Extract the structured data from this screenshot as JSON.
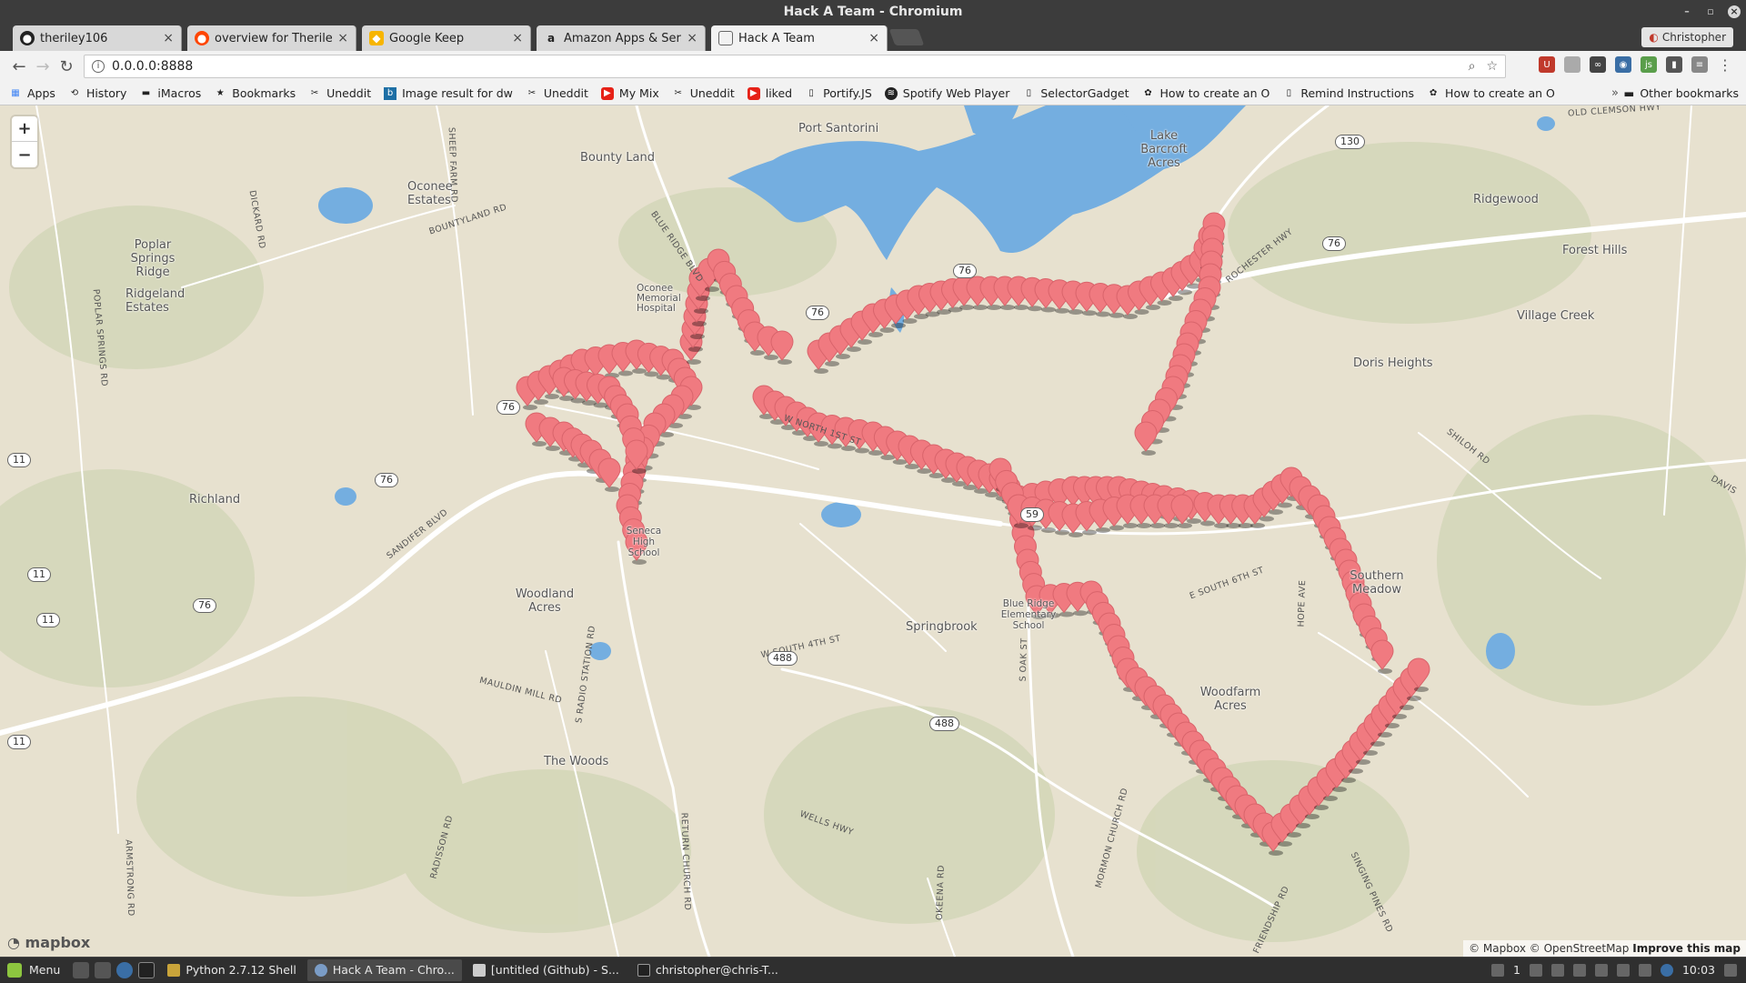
{
  "window": {
    "title": "Hack A Team - Chromium"
  },
  "tabs": [
    {
      "label": "theriley106",
      "icon": "github-icon"
    },
    {
      "label": "overview for Theriley106",
      "icon": "reddit-icon"
    },
    {
      "label": "Google Keep",
      "icon": "keep-icon"
    },
    {
      "label": "Amazon Apps & Services",
      "icon": "amazon-icon"
    },
    {
      "label": "Hack A Team",
      "icon": "page-icon"
    }
  ],
  "profile": {
    "name": "Christopher"
  },
  "address": {
    "url": "0.0.0.0:8888"
  },
  "bookmarks": [
    {
      "label": "Apps",
      "icon": "apps-grid-icon"
    },
    {
      "label": "History",
      "icon": "history-icon"
    },
    {
      "label": "iMacros",
      "icon": "folder-icon"
    },
    {
      "label": "Bookmarks",
      "icon": "star-icon"
    },
    {
      "label": "Uneddit",
      "icon": "scissors-icon"
    },
    {
      "label": "Image result for dw",
      "icon": "bing-icon"
    },
    {
      "label": "Uneddit",
      "icon": "scissors-icon"
    },
    {
      "label": "My Mix",
      "icon": "youtube-icon"
    },
    {
      "label": "Uneddit",
      "icon": "scissors-icon"
    },
    {
      "label": "liked",
      "icon": "youtube-icon"
    },
    {
      "label": "Portify.JS",
      "icon": "page-icon"
    },
    {
      "label": "Spotify Web Player",
      "icon": "spotify-icon"
    },
    {
      "label": "SelectorGadget",
      "icon": "page-icon"
    },
    {
      "label": "How to create an O",
      "icon": "octocat-icon"
    },
    {
      "label": "Remind Instructions",
      "icon": "page-icon"
    },
    {
      "label": "How to create an O",
      "icon": "octocat-icon"
    }
  ],
  "bookmarks_overflow": "»",
  "other_bookmarks": "Other bookmarks",
  "map": {
    "zoom_in": "+",
    "zoom_out": "−",
    "places": [
      "Port Santorini",
      "Lake Barcroft Acres",
      "Bounty Land",
      "Oconee Estates",
      "Poplar Springs Ridge",
      "Ridgeland Estates",
      "Ridgewood",
      "Forest Hills",
      "Village Creek",
      "Doris Heights",
      "Richland",
      "Seneca High School",
      "Woodland Acres",
      "Blue Ridge Elementary School",
      "Springbrook",
      "Southern Meadow",
      "Woodfarm Acres",
      "The Woods",
      "Oconee Memorial Hospital"
    ],
    "roads": [
      "SHEEP FARM RD",
      "BLUE RIDGE BLVD",
      "BOUNTYLAND RD",
      "DICKARD RD",
      "POPLAR SPRINGS RD",
      "SANDIFER BLVD",
      "ROCHESTER HWY",
      "W NORTH 1ST ST",
      "W SOUTH 4TH ST",
      "E SOUTH 6TH ST",
      "S OAK ST",
      "WELLS HWY",
      "S RADIO STATION RD",
      "MAULDIN MILL RD",
      "RETURN CHURCH RD",
      "RADISSON RD",
      "ARMSTRONG RD",
      "OKEENA RD",
      "MORMON CHURCH RD",
      "HOPE AVE",
      "SHILOH RD",
      "SINGING PINES RD",
      "FRIENDSHIP RD",
      "OLD CLEMSON HWY",
      "DAVIS"
    ],
    "shields": [
      "130",
      "76",
      "76",
      "76",
      "76",
      "76",
      "76",
      "11",
      "11",
      "11",
      "11",
      "59",
      "488",
      "488"
    ],
    "logo": "mapbox",
    "attribution": "© Mapbox © OpenStreetMap",
    "improve": "Improve this map",
    "marker_color": "#f07a80"
  },
  "taskbar": {
    "menu": "Menu",
    "tasks": [
      "Python 2.7.12 Shell",
      "Hack A Team - Chro...",
      "[untitled (Github) - S...",
      "christopher@chris-T..."
    ],
    "clock": "10:03",
    "badge": "1"
  }
}
